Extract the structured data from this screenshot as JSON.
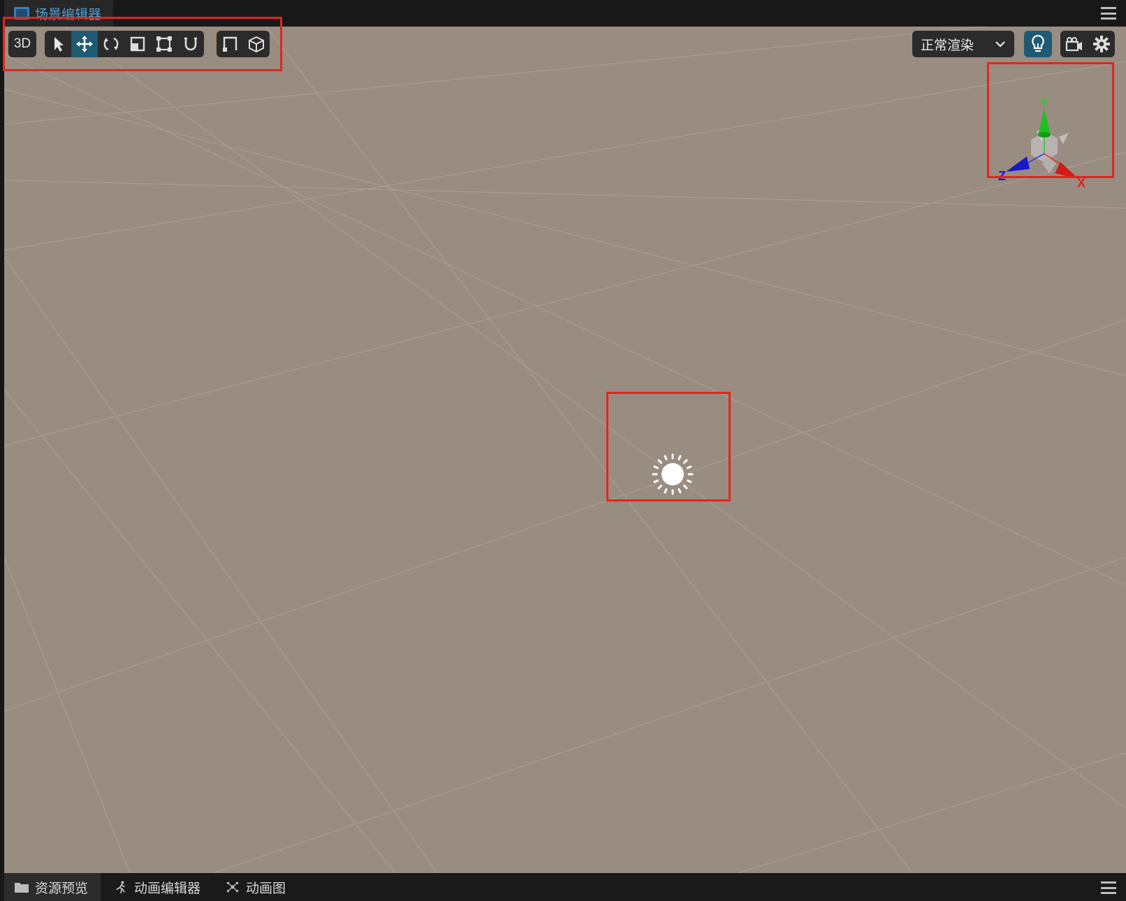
{
  "window": {
    "tab_title": "场景编辑器"
  },
  "toolbar": {
    "mode_label": "3D",
    "tools": [
      "select-arrow-icon",
      "move-icon",
      "rotate-icon",
      "scale-icon",
      "rect-icon",
      "snap-magnet-icon"
    ],
    "active_tool": "move-icon",
    "extra_tools": [
      "local-space-icon",
      "box-view-icon"
    ]
  },
  "render": {
    "mode_label": "正常渲染"
  },
  "right_icons": [
    "lightbulb-icon",
    "camera-icon",
    "gear-icon"
  ],
  "gizmo": {
    "axis_x": "X",
    "axis_y": "Y",
    "axis_z": "Z"
  },
  "scene": {
    "light_icon": "sun-icon"
  },
  "bottom_tabs": [
    {
      "label": "资源预览",
      "icon": "folder-icon",
      "active": true
    },
    {
      "label": "动画编辑器",
      "icon": "running-figure-icon",
      "active": false
    },
    {
      "label": "动画图",
      "icon": "graph-icon",
      "active": false
    }
  ],
  "colors": {
    "highlight": "#e3261c",
    "accent": "#1f5a72",
    "floor": "#998c81"
  }
}
